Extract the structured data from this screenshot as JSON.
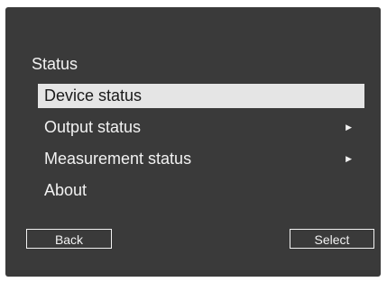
{
  "header": {
    "title": "Status"
  },
  "menu": {
    "items": [
      {
        "label": "Device status",
        "selected": true,
        "has_submenu": false
      },
      {
        "label": "Output status",
        "selected": false,
        "has_submenu": true
      },
      {
        "label": "Measurement status",
        "selected": false,
        "has_submenu": true
      },
      {
        "label": "About",
        "selected": false,
        "has_submenu": false
      }
    ],
    "submenu_icon": "triangle-right-icon"
  },
  "footer": {
    "back_label": "Back",
    "select_label": "Select"
  },
  "colors": {
    "screen_background": "#3a3a3a",
    "text": "#f2f2f2",
    "highlight": "#e5e5e5",
    "highlight_text": "#1a1a1a"
  }
}
